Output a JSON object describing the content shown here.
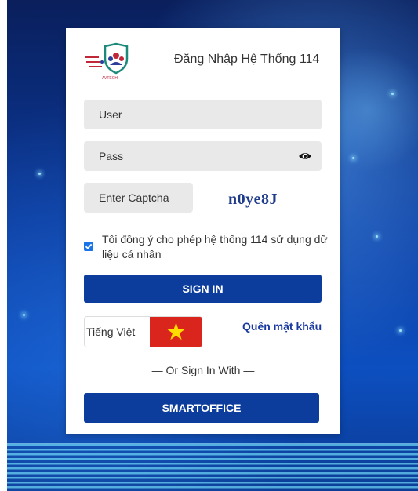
{
  "header": {
    "title": "Đăng Nhập Hệ Thống 114",
    "logo_text": "AVTECH"
  },
  "form": {
    "user_placeholder": "User",
    "pass_placeholder": "Pass",
    "captcha_placeholder": "Enter Captcha",
    "captcha_code": "n0ye8J",
    "consent_text": "Tôi đồng ý cho phép hệ thống 114 sử dụng dữ liệu cá nhân",
    "consent_checked": true,
    "signin_label": "SIGN IN",
    "language_label": "Tiếng Việt",
    "forgot_label": "Quên mật khẩu",
    "or_text": "— Or Sign In With —",
    "smartoffice_label": "SMARTOFFICE"
  },
  "colors": {
    "primary": "#0d3d9c",
    "link": "#1a3aa0",
    "flag_red": "#da251d",
    "flag_star": "#ffdd00",
    "field_bg": "#e9e9e9"
  },
  "icons": {
    "password_toggle": "eye-icon",
    "language_flag": "vietnam-flag-icon",
    "consent_check": "checkbox-icon"
  }
}
